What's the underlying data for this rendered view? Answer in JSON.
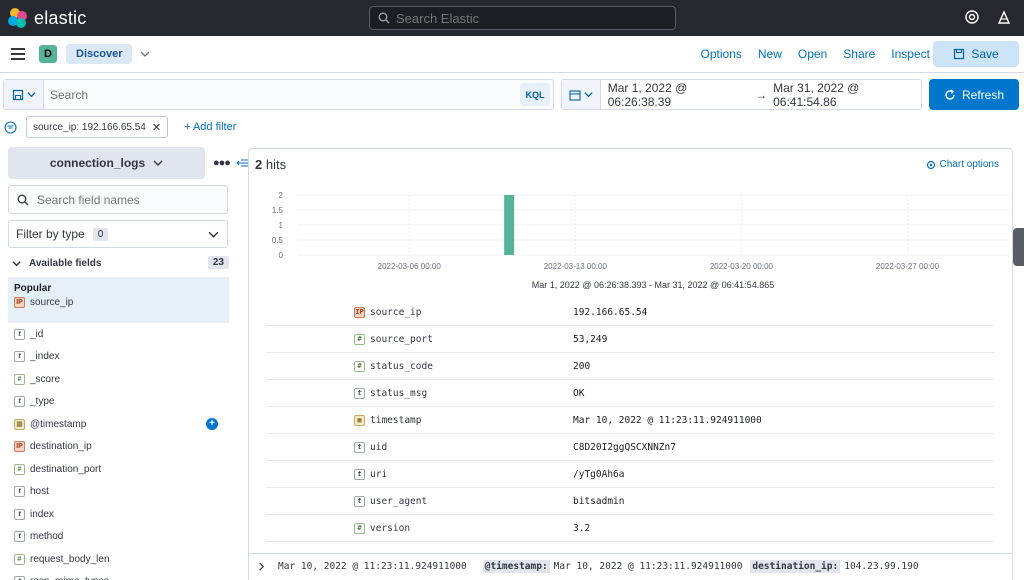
{
  "topbar": {
    "brand": "elastic",
    "search_placeholder": "Search Elastic"
  },
  "appbar": {
    "space_initial": "D",
    "breadcrumb": "Discover",
    "menu": [
      "Options",
      "New",
      "Open",
      "Share",
      "Inspect"
    ],
    "save_label": "Save"
  },
  "query": {
    "placeholder": "Search",
    "language": "KQL"
  },
  "date": {
    "start": "Mar 1, 2022 @ 06:26:38.39",
    "arrow": "→",
    "end": "Mar 31, 2022 @ 06:41:54.86",
    "refresh_label": "Refresh"
  },
  "filters": {
    "pill": "source_ip: 192.166.65.54",
    "add_label": "+ Add filter"
  },
  "sidebar": {
    "index_pattern": "connection_logs",
    "field_search_placeholder": "Search field names",
    "filter_by_type": "Filter by type",
    "filter_count": "0",
    "available_label": "Available fields",
    "available_count": "23",
    "popular_label": "Popular",
    "popular_fields": [
      {
        "name": "source_ip",
        "type": "ip",
        "token": "IP"
      }
    ],
    "fields": [
      {
        "name": "_id",
        "type": "string",
        "token": "t"
      },
      {
        "name": "_index",
        "type": "string",
        "token": "t"
      },
      {
        "name": "_score",
        "type": "number",
        "token": "#"
      },
      {
        "name": "_type",
        "type": "string",
        "token": "t"
      },
      {
        "name": "@timestamp",
        "type": "date",
        "token": "▦"
      },
      {
        "name": "destination_ip",
        "type": "ip",
        "token": "IP"
      },
      {
        "name": "destination_port",
        "type": "number",
        "token": "#"
      },
      {
        "name": "host",
        "type": "string",
        "token": "t"
      },
      {
        "name": "index",
        "type": "string",
        "token": "t"
      },
      {
        "name": "method",
        "type": "string",
        "token": "t"
      },
      {
        "name": "request_body_len",
        "type": "number",
        "token": "#"
      },
      {
        "name": "resp_mime_types",
        "type": "string",
        "token": "t"
      }
    ]
  },
  "main": {
    "hits_count": "2",
    "hits_label": "hits",
    "chart_options_label": "Chart options",
    "doc_fields": [
      {
        "name": "source_ip",
        "type": "ip",
        "token": "IP",
        "value": "192.166.65.54"
      },
      {
        "name": "source_port",
        "type": "number",
        "token": "#",
        "value": "53,249"
      },
      {
        "name": "status_code",
        "type": "number",
        "token": "#",
        "value": "200"
      },
      {
        "name": "status_msg",
        "type": "string",
        "token": "t",
        "value": "OK"
      },
      {
        "name": "timestamp",
        "type": "date",
        "token": "▦",
        "value": "Mar 10, 2022 @ 11:23:11.924911000"
      },
      {
        "name": "uid",
        "type": "string",
        "token": "t",
        "value": "C8D20I2ggQSCXNNZn7"
      },
      {
        "name": "uri",
        "type": "string",
        "token": "t",
        "value": "/yTg0Ah6a"
      },
      {
        "name": "user_agent",
        "type": "string",
        "token": "t",
        "value": "bitsadmin"
      },
      {
        "name": "version",
        "type": "number",
        "token": "#",
        "value": "3.2"
      }
    ],
    "summary": {
      "time": "Mar 10, 2022 @ 11:23:11.924911000",
      "ts_key": "@timestamp:",
      "ts_val": "Mar 10, 2022 @ 11:23:11.924911000",
      "dst_key": "destination_ip:",
      "dst_val": "104.23.99.190"
    }
  },
  "chart_data": {
    "type": "bar",
    "x_tick_labels": [
      "2022-03-06 00:00",
      "2022-03-13 00:00",
      "2022-03-20 00:00",
      "2022-03-27 00:00"
    ],
    "y_tick_labels": [
      "0",
      "0.5",
      "1",
      "1.5",
      "2"
    ],
    "ylim": [
      0,
      2
    ],
    "xlim": [
      "2022-03-01T06:26:38",
      "2022-03-31T06:41:54"
    ],
    "series": [
      {
        "values": [
          {
            "x": "2022-03-10",
            "y": 2
          }
        ]
      }
    ],
    "bar_color": "#54b399",
    "xlabel": "Mar 1, 2022 @ 06:26:38.393 - Mar 31, 2022 @ 06:41:54.865",
    "grid": true
  },
  "colors": {
    "header_bg": "#25282f",
    "primary": "#0077cc",
    "link": "#0071c2",
    "bar": "#54b399"
  }
}
